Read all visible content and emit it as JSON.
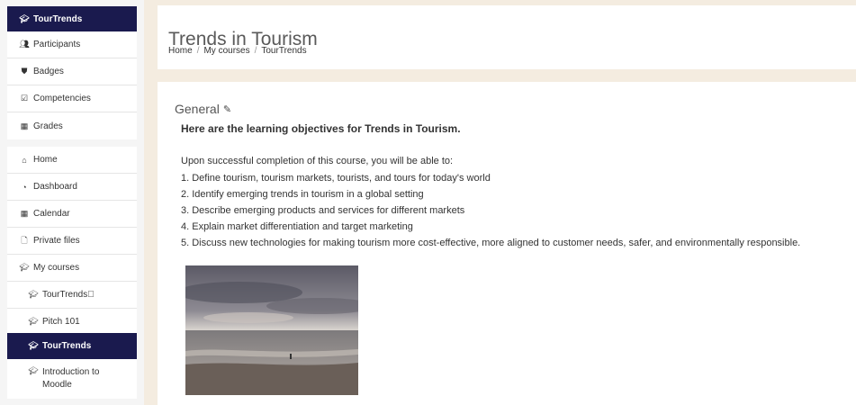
{
  "sidebar": {
    "course_block": [
      {
        "label": "TourTrends",
        "icon": "graduation-cap-icon",
        "active": true
      },
      {
        "label": "Participants",
        "icon": "users-icon"
      },
      {
        "label": "Badges",
        "icon": "shield-icon"
      },
      {
        "label": "Competencies",
        "icon": "check-square-icon"
      },
      {
        "label": "Grades",
        "icon": "table-icon"
      }
    ],
    "nav_block": [
      {
        "label": "Home",
        "icon": "home-icon"
      },
      {
        "label": "Dashboard",
        "icon": "dashboard-icon"
      },
      {
        "label": "Calendar",
        "icon": "calendar-icon"
      },
      {
        "label": "Private files",
        "icon": "file-icon"
      },
      {
        "label": "My courses",
        "icon": "graduation-cap-icon"
      },
      {
        "label": "TourTrends\u0000",
        "icon": "graduation-cap-icon"
      },
      {
        "label": "Pitch 101",
        "icon": "graduation-cap-icon"
      },
      {
        "label": "TourTrends",
        "icon": "graduation-cap-icon",
        "active": true
      },
      {
        "label": "Introduction to Moodle",
        "icon": "graduation-cap-icon"
      }
    ]
  },
  "header": {
    "title": "Trends in Tourism",
    "breadcrumb": [
      "Home",
      "My courses",
      "TourTrends"
    ]
  },
  "section": {
    "title": "General",
    "heading": "Here are the learning objectives for Trends in Tourism.",
    "intro": "Upon successful completion of this course, you will be able to:",
    "objectives": [
      "1.  Define tourism, tourism markets, tourists, and tours for today's world",
      "2.  Identify emerging trends in tourism in a global setting",
      "3.  Describe emerging products and services for different markets",
      "4.  Explain market differentiation and target marketing",
      "5.  Discuss new technologies for making tourism more cost-effective, more aligned to customer needs, safer, and environmentally responsible."
    ]
  },
  "colors": {
    "active_bg": "#1a1a4e",
    "page_bg": "#f4ece0"
  }
}
